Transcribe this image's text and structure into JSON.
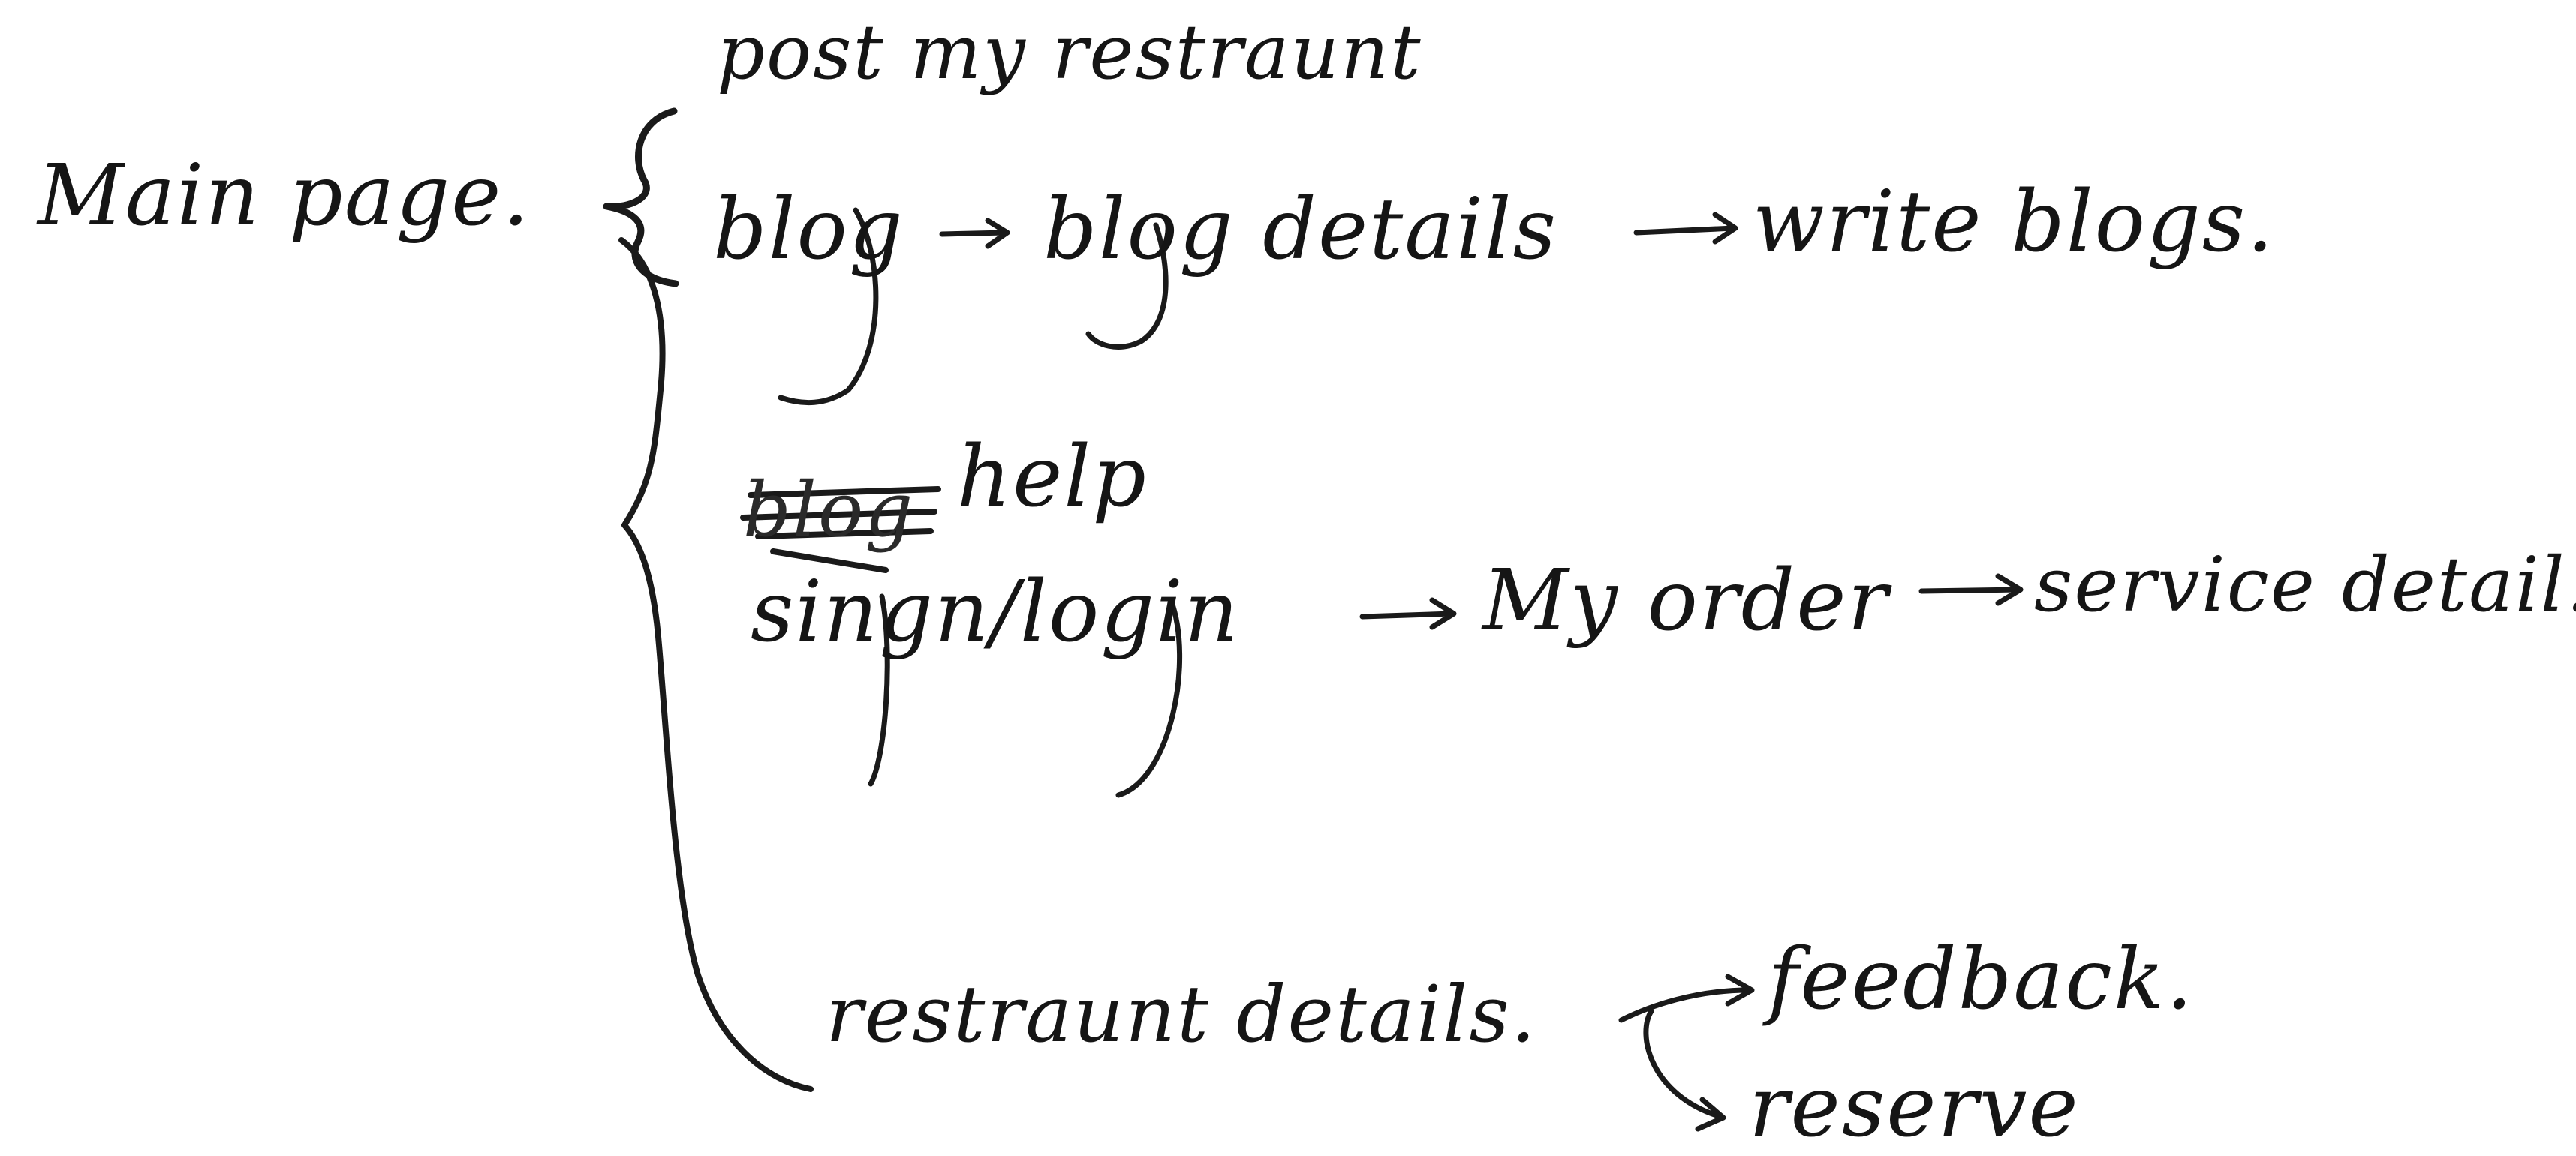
{
  "diagram": {
    "root": "Main page.",
    "children": [
      {
        "label": "post my restraunt"
      },
      {
        "label": "blog",
        "path": [
          "blog details",
          "write blogs."
        ]
      },
      {
        "label": "help",
        "struck_out": "blog"
      },
      {
        "label": "singn/login",
        "path": [
          "My order",
          "service detail."
        ]
      },
      {
        "label": "restraunt details.",
        "branches": [
          "feedback.",
          "reserve"
        ]
      }
    ]
  }
}
